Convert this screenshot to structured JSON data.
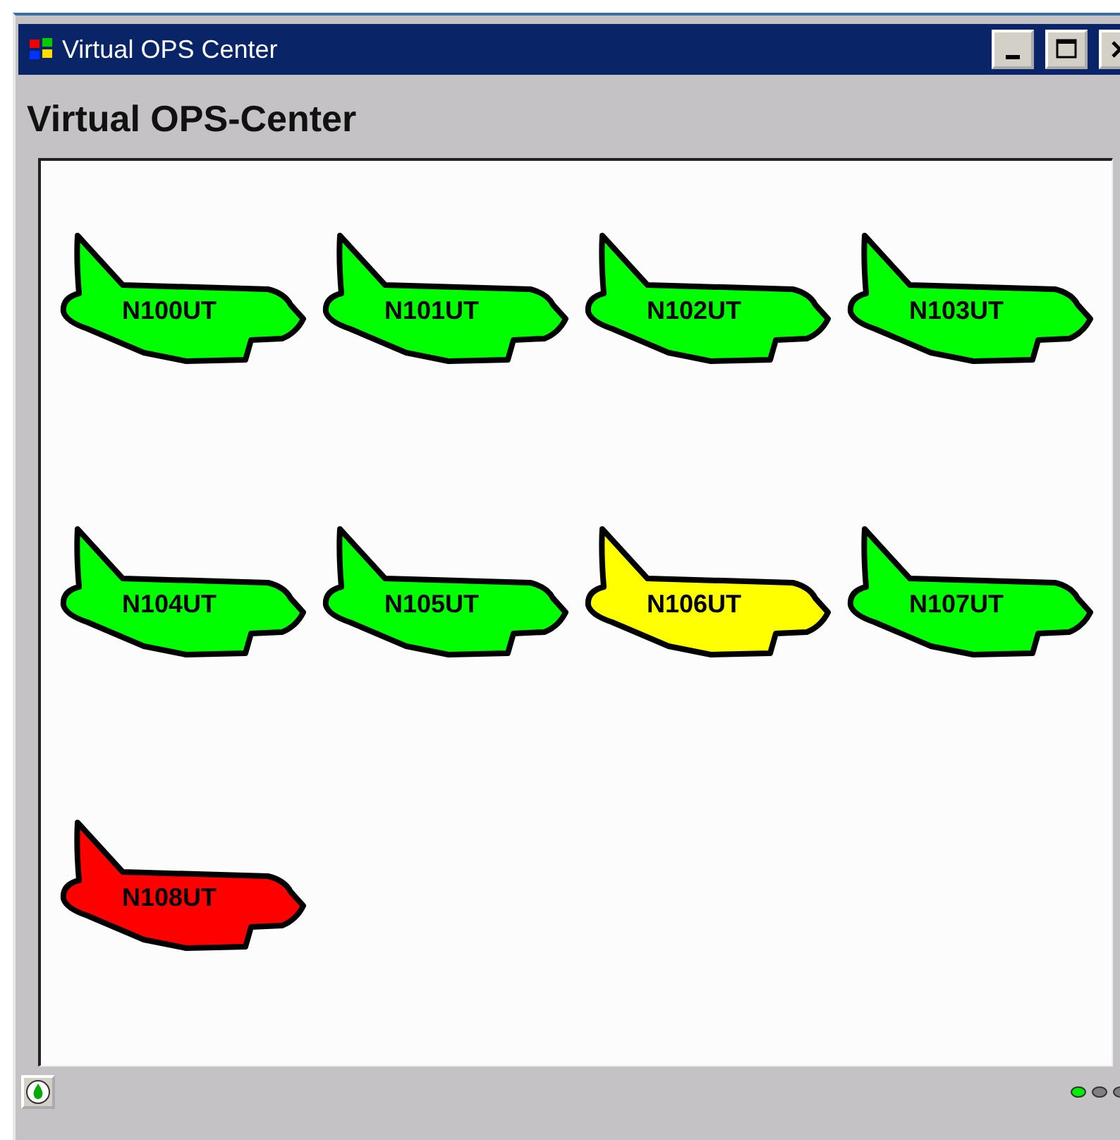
{
  "window": {
    "title": "Virtual OPS Center"
  },
  "heading": "Virtual OPS-Center",
  "aircraft": [
    {
      "tail": "N100UT",
      "color": "#00ff00"
    },
    {
      "tail": "N101UT",
      "color": "#00ff00"
    },
    {
      "tail": "N102UT",
      "color": "#00ff00"
    },
    {
      "tail": "N103UT",
      "color": "#00ff00"
    },
    {
      "tail": "N104UT",
      "color": "#00ff00"
    },
    {
      "tail": "N105UT",
      "color": "#00ff00"
    },
    {
      "tail": "N106UT",
      "color": "#ffff00"
    },
    {
      "tail": "N107UT",
      "color": "#00ff00"
    },
    {
      "tail": "N108UT",
      "color": "#ff0000"
    }
  ],
  "status_bar": {
    "indicators": [
      {
        "color": "#00ee00"
      },
      {
        "color": "#808080"
      },
      {
        "color": "#808080"
      }
    ]
  }
}
